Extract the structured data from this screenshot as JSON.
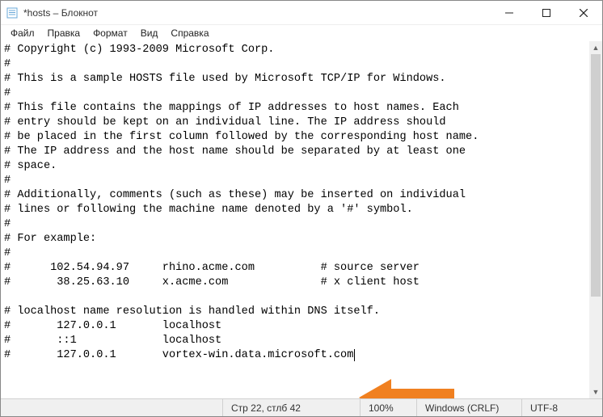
{
  "title": "*hosts – Блокнот",
  "menu": {
    "file": "Файл",
    "edit": "Правка",
    "format": "Формат",
    "view": "Вид",
    "help": "Справка"
  },
  "content": "# Copyright (c) 1993-2009 Microsoft Corp.\n#\n# This is a sample HOSTS file used by Microsoft TCP/IP for Windows.\n#\n# This file contains the mappings of IP addresses to host names. Each\n# entry should be kept on an individual line. The IP address should\n# be placed in the first column followed by the corresponding host name.\n# The IP address and the host name should be separated by at least one\n# space.\n#\n# Additionally, comments (such as these) may be inserted on individual\n# lines or following the machine name denoted by a '#' symbol.\n#\n# For example:\n#\n#      102.54.94.97     rhino.acme.com          # source server\n#       38.25.63.10     x.acme.com              # x client host\n\n# localhost name resolution is handled within DNS itself.\n#       127.0.0.1       localhost\n#       ::1             localhost\n#       127.0.0.1       vortex-win.data.microsoft.com",
  "status": {
    "position": "Стр 22, стлб 42",
    "zoom": "100%",
    "line_ending": "Windows (CRLF)",
    "encoding": "UTF-8"
  }
}
